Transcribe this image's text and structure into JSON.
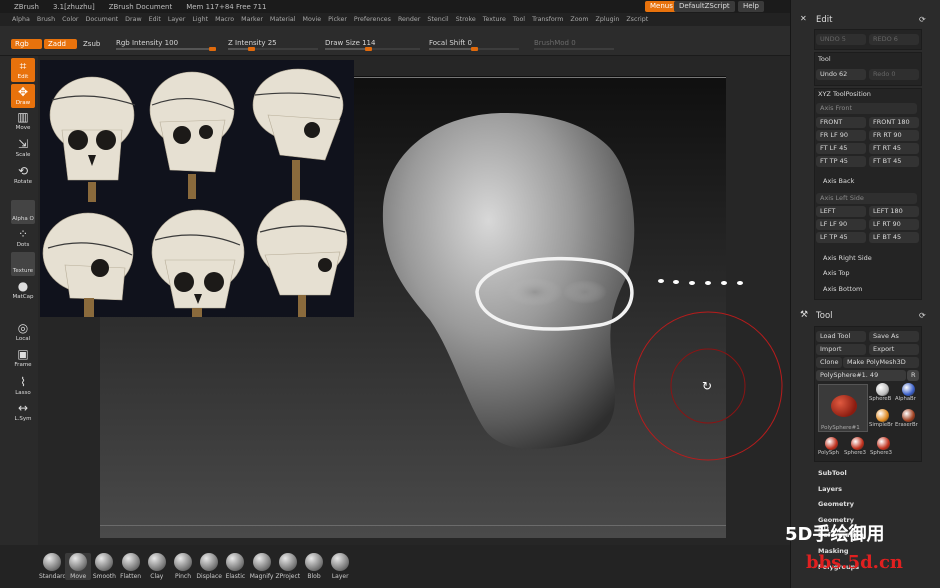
{
  "title_bar": {
    "app": "ZBrush",
    "version": "3.1[zhuzhu]",
    "document": "ZBrush Document",
    "mem": "Mem 117+84 Free 711",
    "menus_btn": "Menus",
    "script_btn": "DefaultZScript",
    "help_btn": "Help"
  },
  "menus": [
    "Alpha",
    "Brush",
    "Color",
    "Document",
    "Draw",
    "Edit",
    "Layer",
    "Light",
    "Macro",
    "Marker",
    "Material",
    "Movie",
    "Picker",
    "Preferences",
    "Render",
    "Stencil",
    "Stroke",
    "Texture",
    "Tool",
    "Transform",
    "Zoom",
    "Zplugin",
    "Zscript"
  ],
  "shelf": {
    "rgb": "Rgb",
    "zadd": "Zadd",
    "zsub": "Zsub",
    "rgb_intensity": "Rgb Intensity 100",
    "z_intensity": "Z Intensity 25",
    "draw_size": "Draw Size 114",
    "focal_shift": "Focal Shift 0",
    "brushmod": "BrushMod 0",
    "z_intensity_level": 0.25,
    "draw_size_level": 0.45,
    "focal_shift_level": 0.5
  },
  "left_tools": [
    {
      "label": "Edit",
      "icon": "edit-icon",
      "active": true
    },
    {
      "label": "Draw",
      "icon": "draw-icon",
      "active": true
    },
    {
      "label": "Move",
      "icon": "move-icon",
      "active": false
    },
    {
      "label": "Scale",
      "icon": "scale-icon",
      "active": false
    },
    {
      "label": "Rotate",
      "icon": "rotate-icon",
      "active": false
    },
    {
      "label": "Alpha  O",
      "icon": "alpha-icon",
      "active": false
    },
    {
      "label": "Dots",
      "icon": "dots-icon",
      "active": false
    },
    {
      "label": "Texture",
      "icon": "texture-icon",
      "active": false
    },
    {
      "label": "MatCap",
      "icon": "matcap-icon",
      "active": false
    },
    {
      "label": "Local",
      "icon": "local-icon",
      "active": false
    },
    {
      "label": "Frame",
      "icon": "frame-icon",
      "active": false
    },
    {
      "label": "Lasso",
      "icon": "lasso-icon",
      "active": false
    },
    {
      "label": "L.Sym",
      "icon": "lsym-icon",
      "active": false
    }
  ],
  "edit_panel": {
    "title": "Edit",
    "undo": "UNDO 5",
    "redo": "REDO 6"
  },
  "tool_mini": {
    "title": "Tool",
    "undo": "Undo 62",
    "redo": "Redo 0"
  },
  "xyz": {
    "title": "XYZ ToolPosition",
    "axis_front": "Axis Front",
    "front_btns": [
      "FRONT",
      "FRONT 180",
      "FR LF 90",
      "FR RT 90",
      "FT LF 45",
      "FT RT 45",
      "FT TP 45",
      "FT BT 45"
    ],
    "axis_back": "Axis Back",
    "axis_left_side": "Axis Left Side",
    "left_btns": [
      "LEFT",
      "LEFT 180",
      "LF LF 90",
      "LF RT 90",
      "LF TP 45",
      "LF BT 45"
    ],
    "axis_right": "Axis Right Side",
    "axis_top": "Axis Top",
    "axis_bottom": "Axis Bottom"
  },
  "tool_panel": {
    "title": "Tool",
    "load": "Load Tool",
    "save": "Save As",
    "import": "Import",
    "export": "Export",
    "clone": "Clone",
    "make_poly": "Make PolyMesh3D",
    "current": "PolySphere#1. 49",
    "r": "R",
    "thumb_main": "PolySphere#1",
    "thumbs": [
      "SphereB",
      "AlphaBr",
      "SimpleBr",
      "EraserBr",
      "PolySph",
      "Sphere3",
      "Sphere3"
    ],
    "subsections": [
      "SubTool",
      "Layers",
      "Geometry",
      "Geometry HD",
      "Deformation",
      "Masking",
      "Polygroups"
    ]
  },
  "bottom_brushes": [
    "Standard",
    "Move",
    "Smooth",
    "Flatten",
    "Clay",
    "Pinch",
    "Displace",
    "Elastic",
    "Magnify",
    "ZProject",
    "Blob",
    "Layer"
  ],
  "watermark": {
    "line1": "5D手绘御用",
    "line2": "bbs.5d.cn"
  }
}
